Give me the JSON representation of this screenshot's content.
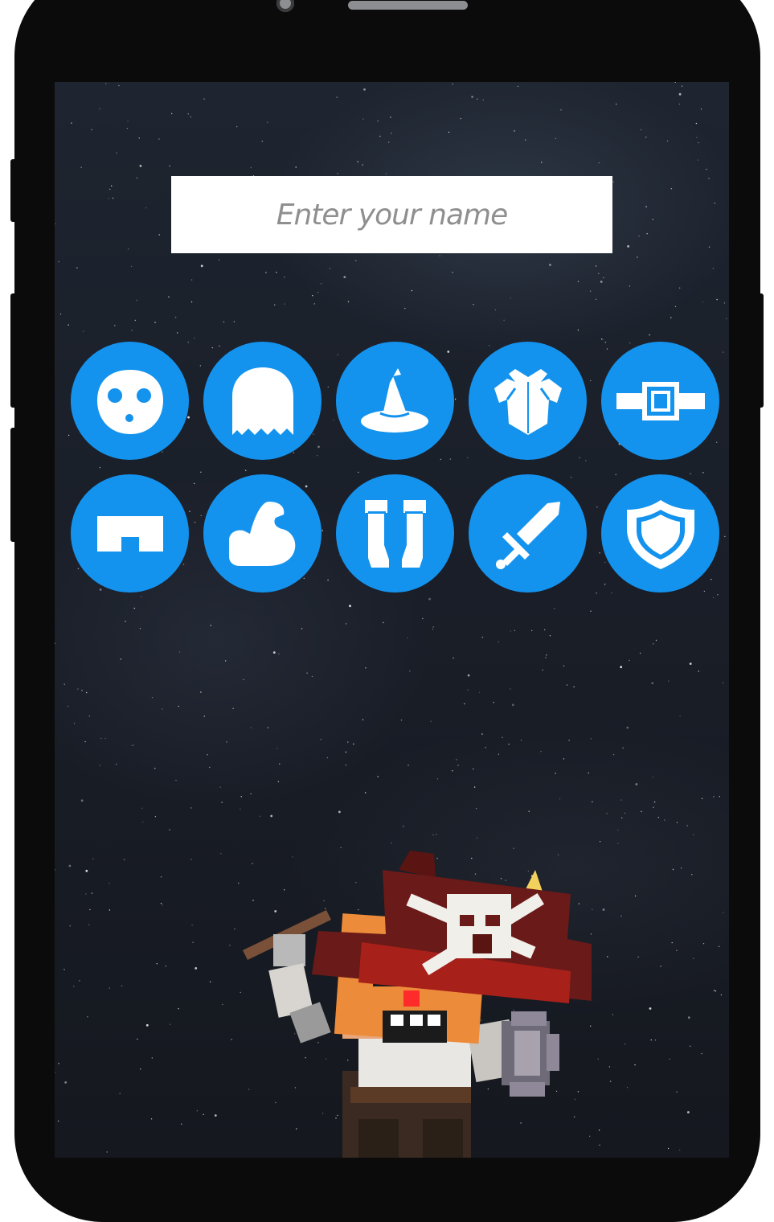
{
  "name_field": {
    "placeholder": "Enter your name",
    "value": ""
  },
  "customization_slots": [
    {
      "id": "face",
      "icon": "face-icon"
    },
    {
      "id": "hair",
      "icon": "hair-icon"
    },
    {
      "id": "hat",
      "icon": "wizard-hat-icon"
    },
    {
      "id": "armor",
      "icon": "armor-icon"
    },
    {
      "id": "belt",
      "icon": "belt-icon"
    },
    {
      "id": "pants",
      "icon": "pants-icon"
    },
    {
      "id": "arms",
      "icon": "arm-muscle-icon"
    },
    {
      "id": "boots",
      "icon": "boots-icon"
    },
    {
      "id": "weapon",
      "icon": "sword-icon"
    },
    {
      "id": "shield",
      "icon": "shield-icon"
    }
  ],
  "colors": {
    "slot_background": "#1493ee",
    "slot_icon": "#ffffff",
    "phone_frame": "#0b0b0c",
    "input_background": "#ffffff",
    "placeholder_text": "#8f8f8f"
  },
  "character": {
    "description_icon": "pirate-character"
  }
}
